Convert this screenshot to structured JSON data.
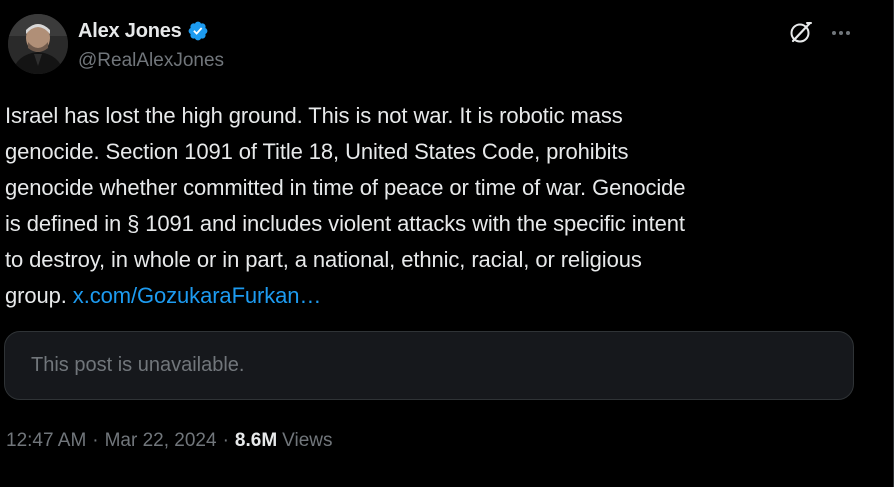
{
  "author": {
    "display_name": "Alex Jones",
    "handle": "@RealAlexJones",
    "verified": true,
    "verified_color": "#1d9bf0",
    "avatar_icon": "profile-photo"
  },
  "header_actions": {
    "grok_icon": "grok-icon",
    "more_icon": "more-horizontal-icon"
  },
  "post": {
    "text": "Israel has lost the high ground. This is not war. It is robotic mass\ngenocide. Section 1091 of Title 18, United States Code, prohibits\ngenocide whether committed in time of peace or time of war. Genocide\nis defined in § 1091 and includes violent attacks with the specific intent\nto destroy, in whole or in part, a national, ethnic, racial, or religious\ngroup. ",
    "link_text": "x.com/GozukaraFurkan…",
    "link_color": "#1d9bf0"
  },
  "quote": {
    "text": "This post is unavailable."
  },
  "meta": {
    "time": "12:47 AM",
    "separator": "·",
    "date": "Mar 22, 2024",
    "views_count": "8.6M",
    "views_label": "Views"
  },
  "colors": {
    "background": "#000000",
    "primary_text": "#e7e9ea",
    "secondary_text": "#71767b",
    "border": "#2f3336",
    "quote_bg": "#16181c"
  }
}
